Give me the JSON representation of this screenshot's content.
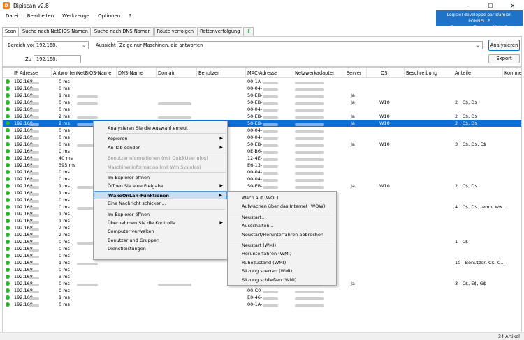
{
  "window": {
    "title": "Dipiscan v2.8",
    "minimize": "–",
    "maximize": "☐",
    "close": "✕"
  },
  "menu": [
    "Datei",
    "Bearbeiten",
    "Werkzeuge",
    "Optionen",
    "?"
  ],
  "banner": {
    "line1": "Logiciel développé par Damien PONNELLE",
    "line2": "Freeware offert par Dipisoft"
  },
  "tabs": [
    "Scan",
    "Suche nach NetBIOS-Namen",
    "Suche nach DNS-Namen",
    "Route verfolgen",
    "Rottenverfolgung",
    "+"
  ],
  "form": {
    "bereich_label": "Bereich von",
    "bereich_value": "192.168.",
    "zu_label": "Zu",
    "zu_value": "192.168.",
    "ansicht_label": "Aussicht",
    "ansicht_value": "Zeige nur Maschinen, die antworten",
    "analyse_button": "Analysieren",
    "export_button": "Export"
  },
  "columns": [
    "IP Adresse",
    "Antworten",
    "NetBIOS-Name",
    "DNS-Name",
    "Domain",
    "Benutzer",
    "MAC-Adresse",
    "Netzwerkadapter",
    "Server",
    "OS",
    "Beschreibung",
    "Anteile",
    "Kommen"
  ],
  "rows": [
    {
      "ip": "192.168.",
      "t": "0 ms",
      "nb": 0,
      "dns": 0,
      "dom": 0,
      "mac": "00-1A-",
      "na": 1,
      "srv": "",
      "os": "",
      "sh": ""
    },
    {
      "ip": "192.168.",
      "t": "0 ms",
      "nb": 0,
      "dns": 0,
      "dom": 0,
      "mac": "00-04-",
      "na": 1,
      "srv": "",
      "os": "",
      "sh": ""
    },
    {
      "ip": "192.168.",
      "t": "1 ms",
      "nb": 1,
      "dns": 0,
      "dom": 0,
      "mac": "50-EB-",
      "na": 1,
      "srv": "Ja",
      "os": "",
      "sh": ""
    },
    {
      "ip": "192.168.",
      "t": "0 ms",
      "nb": 1,
      "dns": 0,
      "dom": 1,
      "mac": "50-EB-",
      "na": 1,
      "srv": "Ja",
      "os": "W10",
      "sh": "2 : C$, D$"
    },
    {
      "ip": "192.168.",
      "t": "0 ms",
      "nb": 0,
      "dns": 0,
      "dom": 0,
      "mac": "00-04-",
      "na": 1,
      "srv": "",
      "os": "",
      "sh": ""
    },
    {
      "ip": "192.168.",
      "t": "2 ms",
      "nb": 1,
      "dns": 0,
      "dom": 1,
      "mac": "50-EB-",
      "na": 1,
      "srv": "Ja",
      "os": "W10",
      "sh": "2 : C$, D$"
    },
    {
      "ip": "192.168.",
      "t": "2 ms",
      "nb": 1,
      "dns": 0,
      "dom": 1,
      "mac": "50-EB-",
      "na": 1,
      "srv": "Ja",
      "os": "W10",
      "sh": "2 : C$, D$",
      "sel": true
    },
    {
      "ip": "192.168.",
      "t": "0 ms",
      "nb": 0,
      "dns": 0,
      "dom": 0,
      "mac": "00-04-",
      "na": 1,
      "srv": "",
      "os": "",
      "sh": ""
    },
    {
      "ip": "192.168.",
      "t": "0 ms",
      "nb": 0,
      "dns": 0,
      "dom": 0,
      "mac": "00-04-",
      "na": 1,
      "srv": "",
      "os": "",
      "sh": ""
    },
    {
      "ip": "192.168.",
      "t": "0 ms",
      "nb": 1,
      "dns": 0,
      "dom": 1,
      "mac": "50-EB-",
      "na": 1,
      "srv": "Ja",
      "os": "W10",
      "sh": "3 : C$, D$, E$"
    },
    {
      "ip": "192.168.",
      "t": "0 ms",
      "nb": 0,
      "dns": 0,
      "dom": 0,
      "mac": "0E-B6-",
      "na": 1,
      "srv": "",
      "os": "",
      "sh": ""
    },
    {
      "ip": "192.168.",
      "t": "40 ms",
      "nb": 0,
      "dns": 0,
      "dom": 0,
      "mac": "12-4E-",
      "na": 1,
      "srv": "",
      "os": "",
      "sh": ""
    },
    {
      "ip": "192.168.",
      "t": "395 ms",
      "nb": 0,
      "dns": 0,
      "dom": 0,
      "mac": "E6-13-",
      "na": 1,
      "srv": "",
      "os": "",
      "sh": ""
    },
    {
      "ip": "192.168.",
      "t": "0 ms",
      "nb": 0,
      "dns": 0,
      "dom": 0,
      "mac": "00-04-",
      "na": 1,
      "srv": "",
      "os": "",
      "sh": ""
    },
    {
      "ip": "192.168.",
      "t": "0 ms",
      "nb": 0,
      "dns": 0,
      "dom": 0,
      "mac": "00-04-",
      "na": 1,
      "srv": "",
      "os": "",
      "sh": ""
    },
    {
      "ip": "192.168.",
      "t": "1 ms",
      "nb": 1,
      "dns": 0,
      "dom": 1,
      "mac": "50-EB-",
      "na": 1,
      "srv": "Ja",
      "os": "W10",
      "sh": "2 : C$, D$"
    },
    {
      "ip": "192.168.",
      "t": "1 ms",
      "nb": 0,
      "dns": 0,
      "dom": 0,
      "mac": "",
      "na": 0,
      "srv": "",
      "os": "",
      "sh": ""
    },
    {
      "ip": "192.168.",
      "t": "0 ms",
      "nb": 0,
      "dns": 0,
      "dom": 0,
      "mac": "",
      "na": 0,
      "srv": "",
      "os": "",
      "sh": ""
    },
    {
      "ip": "192.168.",
      "t": "0 ms",
      "nb": 1,
      "dns": 0,
      "dom": 0,
      "mac": "",
      "na": 0,
      "srv": "",
      "os": "",
      "sh": "4 : C$, D$, temp, ww..."
    },
    {
      "ip": "192.168.",
      "t": "1 ms",
      "nb": 0,
      "dns": 0,
      "dom": 0,
      "mac": "",
      "na": 0,
      "srv": "",
      "os": "",
      "sh": ""
    },
    {
      "ip": "192.168.",
      "t": "1 ms",
      "nb": 0,
      "dns": 0,
      "dom": 0,
      "mac": "",
      "na": 0,
      "srv": "",
      "os": "",
      "sh": ""
    },
    {
      "ip": "192.168.",
      "t": "2 ms",
      "nb": 0,
      "dns": 0,
      "dom": 0,
      "mac": "",
      "na": 0,
      "srv": "",
      "os": "",
      "sh": ""
    },
    {
      "ip": "192.168.",
      "t": "2 ms",
      "nb": 0,
      "dns": 0,
      "dom": 0,
      "mac": "",
      "na": 0,
      "srv": "",
      "os": "",
      "sh": ""
    },
    {
      "ip": "192.168.",
      "t": "0 ms",
      "nb": 1,
      "dns": 0,
      "dom": 0,
      "mac": "",
      "na": 0,
      "srv": "",
      "os": "",
      "sh": "1 : C$"
    },
    {
      "ip": "192.168.",
      "t": "0 ms",
      "nb": 0,
      "dns": 0,
      "dom": 0,
      "mac": "",
      "na": 0,
      "srv": "",
      "os": "",
      "sh": ""
    },
    {
      "ip": "192.168.",
      "t": "0 ms",
      "nb": 0,
      "dns": 0,
      "dom": 0,
      "mac": "",
      "na": 0,
      "srv": "",
      "os": "",
      "sh": ""
    },
    {
      "ip": "192.168.",
      "t": "1 ms",
      "nb": 1,
      "dns": 0,
      "dom": 0,
      "mac": "",
      "na": 0,
      "srv": "",
      "os": "",
      "sh": "10 : Benutzer, C$, C..."
    },
    {
      "ip": "192.168.",
      "t": "0 ms",
      "nb": 0,
      "dns": 0,
      "dom": 0,
      "mac": "",
      "na": 0,
      "srv": "",
      "os": "",
      "sh": ""
    },
    {
      "ip": "192.168.",
      "t": "3 ms",
      "nb": 0,
      "dns": 0,
      "dom": 0,
      "mac": "",
      "na": 0,
      "srv": "",
      "os": "",
      "sh": ""
    },
    {
      "ip": "192.168.",
      "t": "0 ms",
      "nb": 1,
      "dns": 0,
      "dom": 1,
      "mac": "00-50-",
      "na": 1,
      "srv": "Ja",
      "os": "",
      "sh": "3 : C$, E$, G$"
    },
    {
      "ip": "192.168.",
      "t": "0 ms",
      "nb": 0,
      "dns": 0,
      "dom": 0,
      "mac": "00-C0-",
      "na": 1,
      "srv": "",
      "os": "",
      "sh": ""
    },
    {
      "ip": "192.168.",
      "t": "1 ms",
      "nb": 0,
      "dns": 0,
      "dom": 0,
      "mac": "E0-46-",
      "na": 1,
      "srv": "",
      "os": "",
      "sh": ""
    },
    {
      "ip": "192.168.",
      "t": "0 ms",
      "nb": 0,
      "dns": 0,
      "dom": 0,
      "mac": "00-1A-",
      "na": 1,
      "srv": "",
      "os": "",
      "sh": ""
    }
  ],
  "context_menu": [
    {
      "label": "Analysieren Sie die Auswahl erneut",
      "sub": false,
      "dis": false
    },
    {
      "sep": true
    },
    {
      "label": "Kopieren",
      "sub": true,
      "dis": false
    },
    {
      "label": "An Tab senden",
      "sub": true,
      "dis": false
    },
    {
      "sep": true
    },
    {
      "label": "Benutzerinformationen (mit QuickUserInfos)",
      "sub": false,
      "dis": true
    },
    {
      "label": "Maschineninformation (mit WmiSysInfos)",
      "sub": false,
      "dis": true
    },
    {
      "sep": true
    },
    {
      "label": "Im Explorer öffnen",
      "sub": false,
      "dis": false
    },
    {
      "label": "Öffnen Sie eine Freigabe",
      "sub": true,
      "dis": false
    },
    {
      "label": "WakeOnLan-Funktionen",
      "sub": true,
      "dis": false,
      "hl": true
    },
    {
      "label": "Eine Nachricht schicken...",
      "sub": false,
      "dis": false
    },
    {
      "sep": true
    },
    {
      "label": "Im Explorer öffnen",
      "sub": false,
      "dis": false
    },
    {
      "label": "Übernehmen Sie die Kontrolle",
      "sub": true,
      "dis": false
    },
    {
      "label": "Computer verwalten",
      "sub": false,
      "dis": false
    },
    {
      "label": "Benutzer und Gruppen",
      "sub": false,
      "dis": false
    },
    {
      "label": "Dienstleistungen",
      "sub": false,
      "dis": false
    }
  ],
  "submenu": [
    {
      "label": "Wach auf (WOL)"
    },
    {
      "label": "Aufwachen über das Internet (WOW)"
    },
    {
      "sep": true
    },
    {
      "label": "Neustart..."
    },
    {
      "label": "Ausschalten..."
    },
    {
      "label": "Neustart/Herunterfahren abbrechen"
    },
    {
      "sep": true
    },
    {
      "label": "Neustart (WMI)"
    },
    {
      "label": "Herunterfahren (WMI)"
    },
    {
      "label": "Ruhezustand (WMI)"
    },
    {
      "label": "Sitzung sperren (WMI)"
    },
    {
      "label": "Sitzung schließen (WMI)"
    }
  ],
  "status": {
    "count": "34 Artikel"
  },
  "colors": {
    "selection": "#0a6fd9",
    "online": "#28b52a",
    "banner": "#1e73c8"
  }
}
